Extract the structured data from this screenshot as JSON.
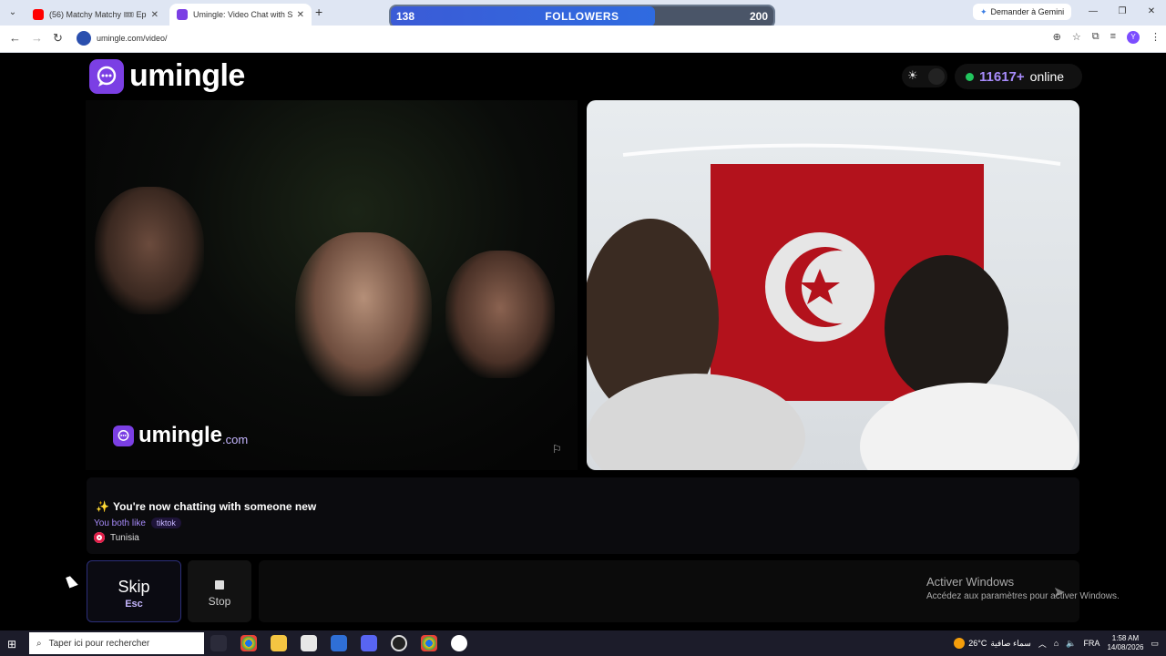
{
  "browser": {
    "tabs": [
      {
        "title": "(56) Matchy Matchy 🎟 Ep 93 V",
        "favicon_color": "#ff0000"
      },
      {
        "title": "Umingle: Video Chat with S",
        "favicon_color": "#7b3fe4",
        "active": true
      }
    ],
    "new_tab": "+",
    "url": "umingle.com/video/",
    "gemini_label": "Demander à Gemini",
    "profile_letter": "Y"
  },
  "overlay": {
    "followers_current": "138",
    "followers_label": "FOLLOWERS",
    "followers_goal": "200",
    "followers_progress": 0.69
  },
  "site": {
    "logo_text": "umingle",
    "online_count": "11617+",
    "online_label": "online"
  },
  "video": {
    "watermark_text": "umingle",
    "watermark_domain": ".com"
  },
  "chat": {
    "connected_message": "You're now chatting with someone new",
    "common_prefix": "You both like",
    "common_interest": "tiktok",
    "country": "Tunisia"
  },
  "controls": {
    "skip_label": "Skip",
    "skip_key": "Esc",
    "stop_label": "Stop"
  },
  "windows": {
    "activate_title": "Activer Windows",
    "activate_sub": "Accédez aux paramètres pour activer Windows.",
    "search_placeholder": "Taper ici pour rechercher",
    "temperature": "26°C",
    "weather": "سماء صافية",
    "lang": "FRA",
    "time": "1:58 AM",
    "date": "14/08/2026"
  }
}
